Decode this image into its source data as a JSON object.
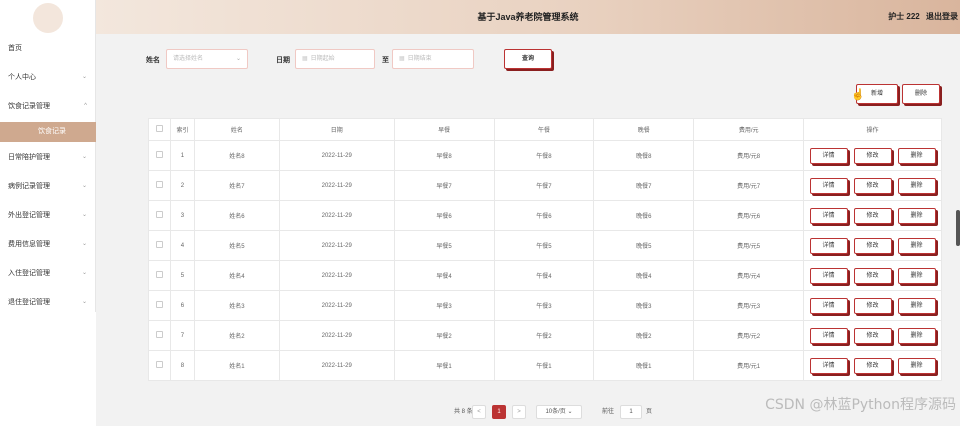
{
  "app": {
    "title": "基于Java养老院管理系统",
    "user_label": "护士 222",
    "logout_label": "退出登录"
  },
  "sidebar": {
    "items": [
      {
        "label": "首页",
        "has_arrow": false
      },
      {
        "label": "个人中心",
        "has_arrow": true
      },
      {
        "label": "饮食记录管理",
        "has_arrow": true,
        "expanded": true
      },
      {
        "label": "饮食记录",
        "sub": true,
        "active": true
      },
      {
        "label": "日常陪护管理",
        "has_arrow": true
      },
      {
        "label": "病例记录管理",
        "has_arrow": true
      },
      {
        "label": "外出登记管理",
        "has_arrow": true
      },
      {
        "label": "费用信息管理",
        "has_arrow": true
      },
      {
        "label": "入住登记管理",
        "has_arrow": true
      },
      {
        "label": "退住登记管理",
        "has_arrow": true
      }
    ]
  },
  "search": {
    "name_label": "姓名",
    "name_placeholder": "请选择姓名",
    "date_label": "日期",
    "date_start_placeholder": "日期起始",
    "to_label": "至",
    "date_end_placeholder": "日期结束",
    "query_button": "查询"
  },
  "toolbar": {
    "add_button": "新增",
    "delete_button": "删除"
  },
  "table": {
    "headers": [
      "索引",
      "姓名",
      "日期",
      "早餐",
      "午餐",
      "晚餐",
      "费用/元",
      "操作"
    ],
    "action_labels": {
      "detail": "详情",
      "edit": "修改",
      "delete": "删除"
    },
    "rows": [
      {
        "index": "1",
        "name": "姓名8",
        "date": "2022-11-29",
        "breakfast": "早餐8",
        "lunch": "午餐8",
        "dinner": "晚餐8",
        "fee": "费用/元8"
      },
      {
        "index": "2",
        "name": "姓名7",
        "date": "2022-11-29",
        "breakfast": "早餐7",
        "lunch": "午餐7",
        "dinner": "晚餐7",
        "fee": "费用/元7"
      },
      {
        "index": "3",
        "name": "姓名6",
        "date": "2022-11-29",
        "breakfast": "早餐6",
        "lunch": "午餐6",
        "dinner": "晚餐6",
        "fee": "费用/元6"
      },
      {
        "index": "4",
        "name": "姓名5",
        "date": "2022-11-29",
        "breakfast": "早餐5",
        "lunch": "午餐5",
        "dinner": "晚餐5",
        "fee": "费用/元5"
      },
      {
        "index": "5",
        "name": "姓名4",
        "date": "2022-11-29",
        "breakfast": "早餐4",
        "lunch": "午餐4",
        "dinner": "晚餐4",
        "fee": "费用/元4"
      },
      {
        "index": "6",
        "name": "姓名3",
        "date": "2022-11-29",
        "breakfast": "早餐3",
        "lunch": "午餐3",
        "dinner": "晚餐3",
        "fee": "费用/元3"
      },
      {
        "index": "7",
        "name": "姓名2",
        "date": "2022-11-29",
        "breakfast": "早餐2",
        "lunch": "午餐2",
        "dinner": "晚餐2",
        "fee": "费用/元2"
      },
      {
        "index": "8",
        "name": "姓名1",
        "date": "2022-11-29",
        "breakfast": "早餐1",
        "lunch": "午餐1",
        "dinner": "晚餐1",
        "fee": "费用/元1"
      }
    ]
  },
  "pagination": {
    "total": "共 8 条",
    "prev": "<",
    "current": "1",
    "next": ">",
    "page_size": "10条/页",
    "goto_label": "前往",
    "goto_value": "1",
    "page_suffix": "页"
  },
  "watermark": "CSDN @林蓝Python程序源码",
  "colors": {
    "accent": "#b33333",
    "accent_shadow": "#8a1f1f",
    "active_menu": "#cfa98f",
    "header_gradient_start": "#f3e7dd",
    "header_gradient_end": "#d9b59d"
  },
  "icons": [
    "calendar-icon",
    "chevron-down-icon",
    "cursor-hand-icon"
  ]
}
